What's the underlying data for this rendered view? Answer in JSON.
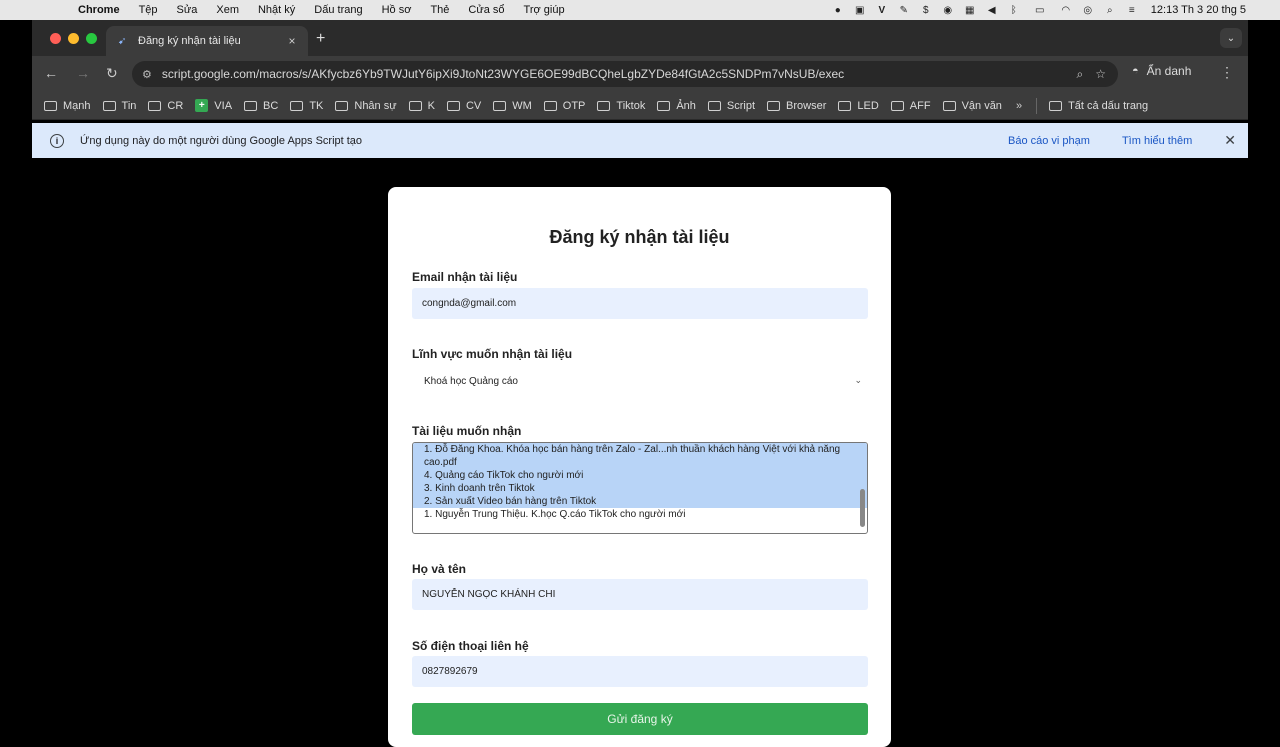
{
  "menubar": {
    "app_name": "Chrome",
    "items": [
      "Tệp",
      "Sửa",
      "Xem",
      "Nhật ký",
      "Dấu trang",
      "Hồ sơ",
      "Thẻ",
      "Cửa sổ",
      "Trợ giúp"
    ],
    "status_icons": [
      "record-icon",
      "camera-icon",
      "v-icon",
      "pen-icon",
      "dollar-icon",
      "media-icon",
      "keyboard-icon",
      "volume-icon",
      "bluetooth-icon",
      "battery-icon",
      "wifi-icon",
      "user-icon",
      "search-icon",
      "control-center-icon"
    ],
    "clock": "12:13 Th 3 20 thg 5"
  },
  "tab": {
    "title": "Đăng ký nhận tài liệu",
    "close": "×"
  },
  "toolbar": {
    "url": "script.google.com/macros/s/AKfycbz6Yb9TWJutY6ipXi9JtoNt23WYGE6OE99dBCQheLgbZYDe84fGtA2c5SNDPm7vNsUB/exec",
    "incognito_label": "Ẩn danh"
  },
  "bookmarks": {
    "items": [
      {
        "label": "Mạnh",
        "icon": "folder"
      },
      {
        "label": "Tin",
        "icon": "folder"
      },
      {
        "label": "CR",
        "icon": "folder"
      },
      {
        "label": "VIA",
        "icon": "sheets"
      },
      {
        "label": "BC",
        "icon": "folder"
      },
      {
        "label": "TK",
        "icon": "folder"
      },
      {
        "label": "Nhân sự",
        "icon": "folder"
      },
      {
        "label": "K",
        "icon": "folder"
      },
      {
        "label": "CV",
        "icon": "folder"
      },
      {
        "label": "WM",
        "icon": "folder"
      },
      {
        "label": "OTP",
        "icon": "folder"
      },
      {
        "label": "Tiktok",
        "icon": "folder"
      },
      {
        "label": "Ảnh",
        "icon": "folder"
      },
      {
        "label": "Script",
        "icon": "folder"
      },
      {
        "label": "Browser",
        "icon": "folder"
      },
      {
        "label": "LED",
        "icon": "folder"
      },
      {
        "label": "AFF",
        "icon": "folder"
      },
      {
        "label": "Vận văn",
        "icon": "folder"
      }
    ],
    "more": "»",
    "all_bookmarks": "Tất cả dấu trang"
  },
  "banner": {
    "message": "Ứng dụng này do một người dùng Google Apps Script tạo",
    "report_link": "Báo cáo vi phạm",
    "learn_more": "Tìm hiểu thêm"
  },
  "form": {
    "title": "Đăng ký nhận tài liệu",
    "email_label": "Email nhận tài liệu",
    "email_value": "congnda@gmail.com",
    "field_label": "Lĩnh vực muốn nhận tài liệu",
    "field_value": "Khoá học Quảng cáo",
    "docs_label": "Tài liệu muốn nhận",
    "docs_options": [
      {
        "text": "1. Đỗ Đăng Khoa. Khóa học bán hàng trên Zalo - Zal...nh thuần khách hàng Việt với khả năng",
        "selected": true
      },
      {
        "text": "cao.pdf",
        "selected": true
      },
      {
        "text": "4. Quảng cáo TikTok cho người mới",
        "selected": true
      },
      {
        "text": "3. Kinh doanh trên Tiktok",
        "selected": true
      },
      {
        "text": "2. Sản xuất Video bán hàng trên Tiktok",
        "selected": true
      },
      {
        "text": "1. Nguyễn Trung Thiệu. K.học Q.cáo TikTok cho người mới",
        "selected": false
      }
    ],
    "name_label": "Họ và tên",
    "name_value": "NGUYỄN NGỌC KHÁNH CHI",
    "phone_label": "Số điện thoại liên hệ",
    "phone_value": "0827892679",
    "submit_label": "Gửi đăng ký"
  },
  "colors": {
    "banner_bg": "#dce9fb",
    "input_bg": "#e8f0fe",
    "selected_option": "#b8d4f7",
    "submit": "#35a853"
  }
}
